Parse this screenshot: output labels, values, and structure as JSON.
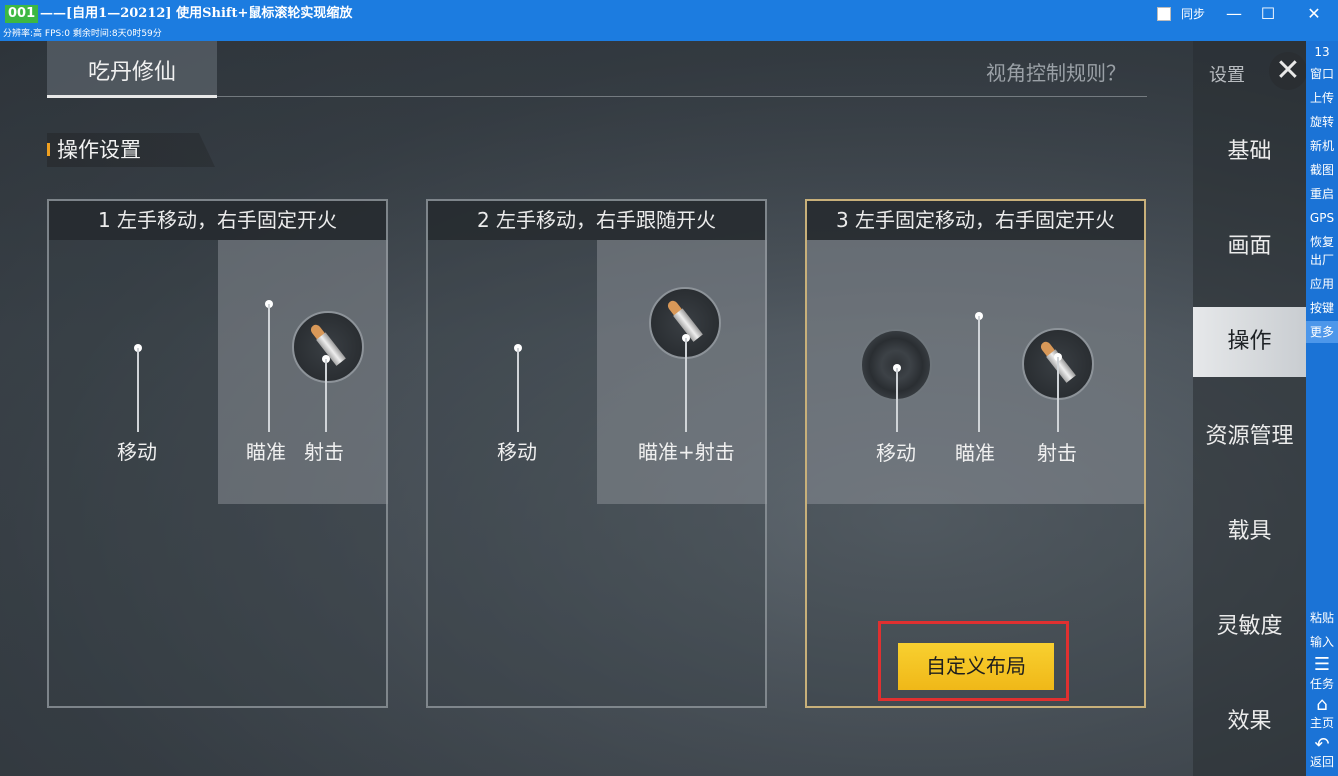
{
  "window": {
    "badge": "001",
    "title": "——[自用1—20212] 使用Shift+鼠标滚轮实现缩放",
    "sync_label": "同步",
    "status": "分辨率:高 FPS:0 剩余时间:8天0时59分",
    "min_icon": "—",
    "max_icon": "☐",
    "close_icon": "✕"
  },
  "game": {
    "tab": "吃丹修仙",
    "view_rules": "视角控制规则？",
    "section": "操作设置",
    "cards": [
      {
        "title": "1 左手移动，右手固定开火",
        "labels": [
          "移动",
          "瞄准",
          "射击"
        ]
      },
      {
        "title": "2 左手移动，右手跟随开火",
        "labels": [
          "移动",
          "瞄准+射击"
        ]
      },
      {
        "title": "3 左手固定移动，右手固定开火",
        "labels": [
          "移动",
          "瞄准",
          "射击"
        ]
      }
    ],
    "custom_layout": "自定义布局",
    "settings_label": "设置",
    "close_glyph": "✕",
    "menu": [
      "基础",
      "画面",
      "操作",
      "资源管理",
      "载具",
      "灵敏度",
      "效果"
    ],
    "active_menu": "操作"
  },
  "toolbar": {
    "count": "13",
    "items": [
      "窗口",
      "上传",
      "旋转",
      "新机",
      "截图",
      "重启",
      "GPS",
      "恢复",
      "出厂",
      "应用",
      "按键",
      "更多"
    ],
    "bottom": [
      "粘贴",
      "输入"
    ],
    "nav": [
      {
        "label": "任务",
        "icon": "menu-icon",
        "glyph": "☰"
      },
      {
        "label": "主页",
        "icon": "home-icon",
        "glyph": "⌂"
      },
      {
        "label": "返回",
        "icon": "back-icon",
        "glyph": "↶"
      }
    ]
  }
}
